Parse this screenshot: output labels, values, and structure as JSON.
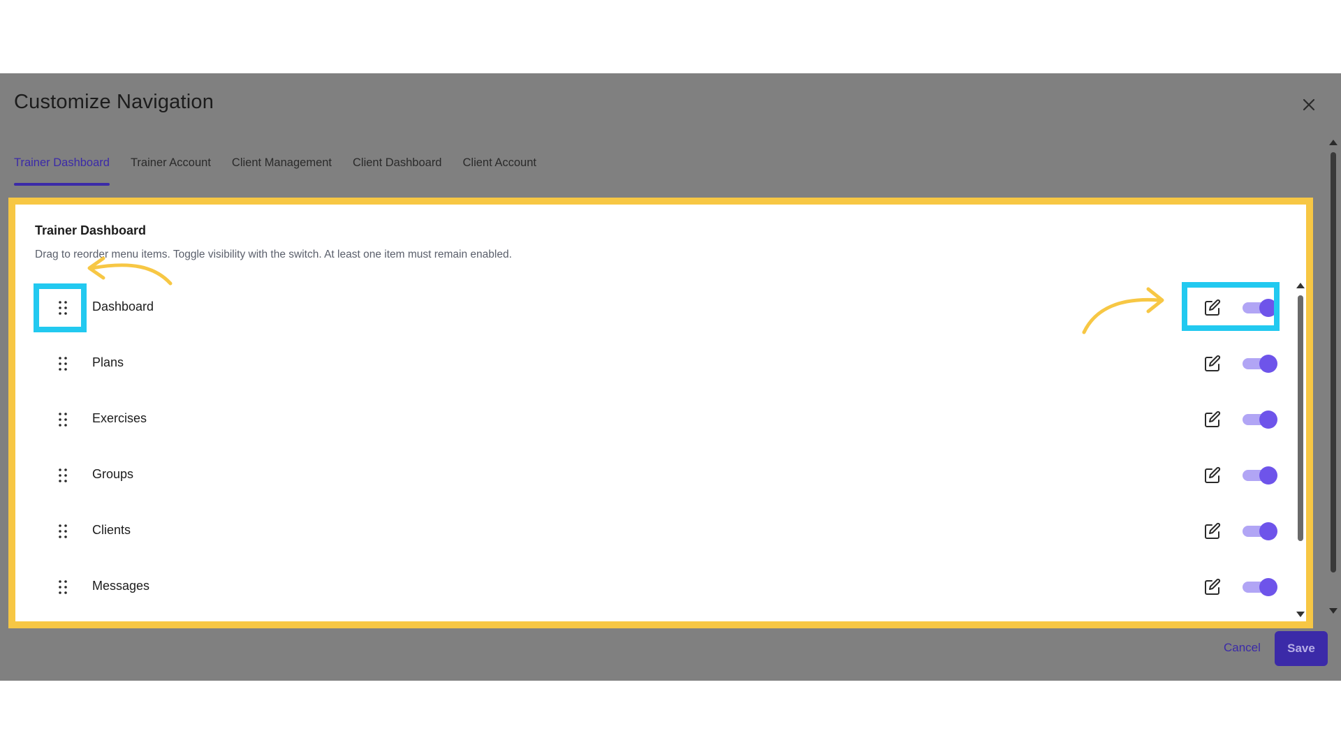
{
  "modal": {
    "title": "Customize Navigation"
  },
  "tabs": [
    {
      "label": "Trainer Dashboard",
      "active": true
    },
    {
      "label": "Trainer Account",
      "active": false
    },
    {
      "label": "Client Management",
      "active": false
    },
    {
      "label": "Client Dashboard",
      "active": false
    },
    {
      "label": "Client Account",
      "active": false
    }
  ],
  "panel": {
    "title": "Trainer Dashboard",
    "description": "Drag to reorder menu items. Toggle visibility with the switch. At least one item must remain enabled.",
    "items": [
      {
        "label": "Dashboard",
        "enabled": true
      },
      {
        "label": "Plans",
        "enabled": true
      },
      {
        "label": "Exercises",
        "enabled": true
      },
      {
        "label": "Groups",
        "enabled": true
      },
      {
        "label": "Clients",
        "enabled": true
      },
      {
        "label": "Messages",
        "enabled": true
      }
    ]
  },
  "footer": {
    "cancel_label": "Cancel",
    "save_label": "Save"
  },
  "icons": {
    "close": "close-icon",
    "drag": "drag-handle-icon",
    "edit": "edit-icon"
  },
  "colors": {
    "accent": "#3b2aa8",
    "toggle_on": "#6e54ea",
    "toggle_track": "#b1a5f5",
    "panel_highlight": "#f7c744",
    "callout_highlight": "#22c9f0",
    "overlay": "#808080"
  }
}
